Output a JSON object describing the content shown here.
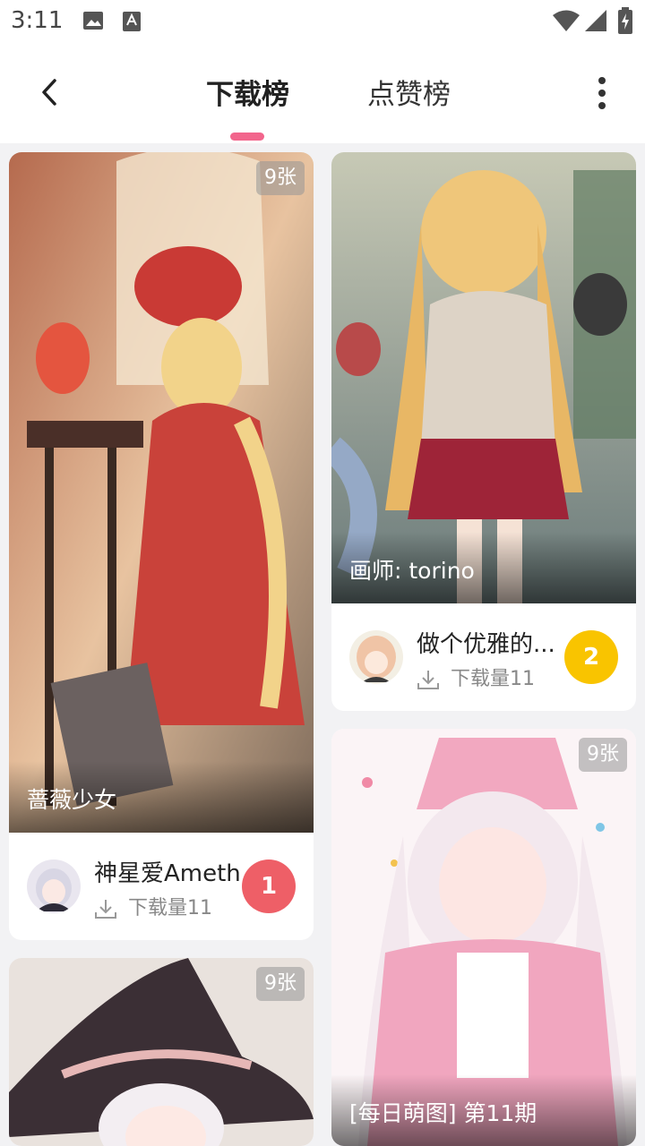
{
  "status_bar": {
    "time": "3:11"
  },
  "header": {
    "tabs": [
      {
        "label": "下载榜",
        "active": true
      },
      {
        "label": "点赞榜",
        "active": false
      }
    ],
    "accent": "#f2658c"
  },
  "cards": [
    {
      "image_count": "9张",
      "caption": "蔷薇少女",
      "author": "神星爱Ameth",
      "download_label": "下载量11",
      "rank": "1",
      "rank_color": "#ee5f67"
    },
    {
      "image_count": "",
      "caption": "画师: torino",
      "author": "做个优雅的...",
      "download_label": "下载量11",
      "rank": "2",
      "rank_color": "#f9c400"
    },
    {
      "image_count": "9张",
      "caption": "[每日萌图] 第11期"
    },
    {
      "image_count": "9张",
      "caption": ""
    }
  ]
}
